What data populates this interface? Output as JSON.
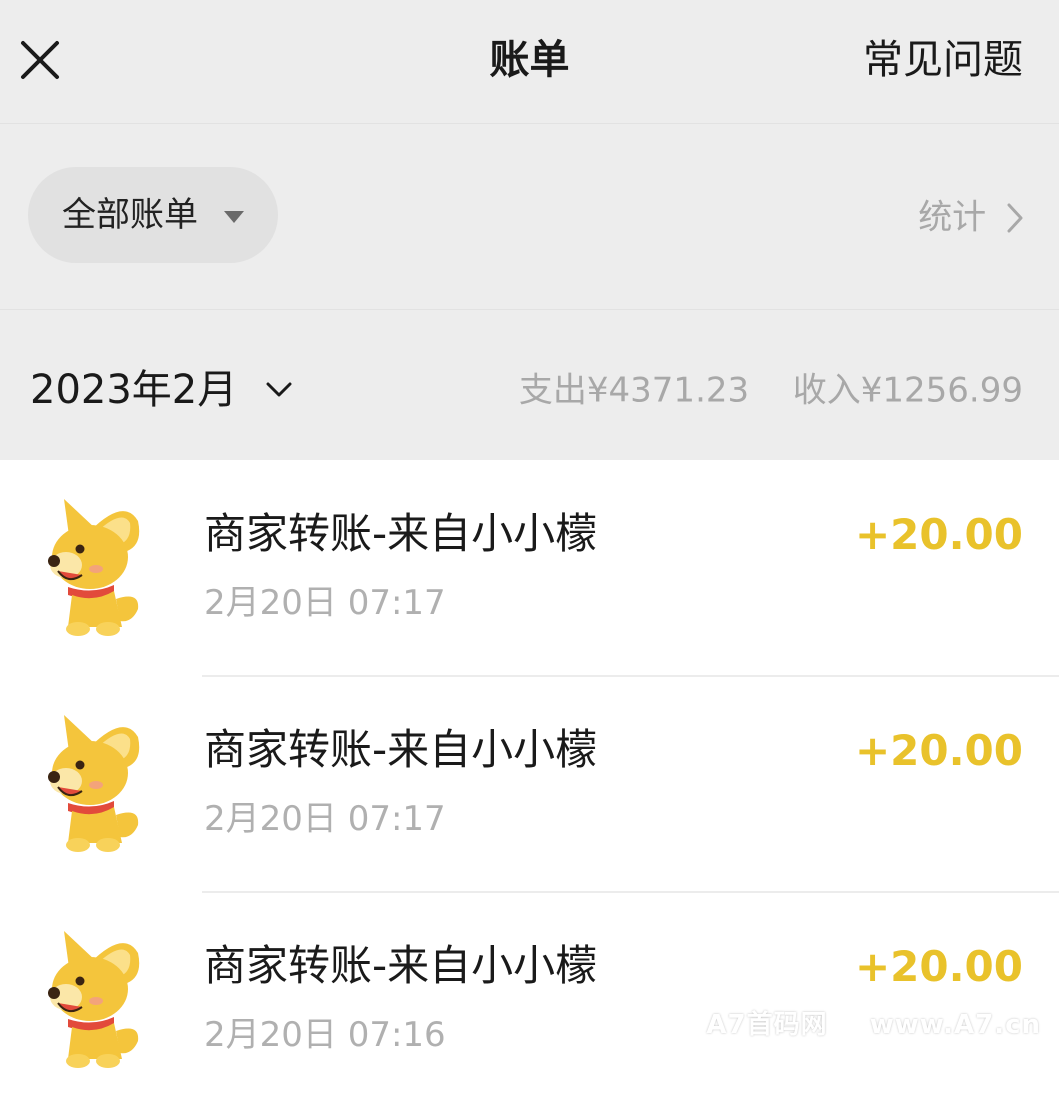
{
  "header": {
    "close_icon": "close-icon",
    "title": "账单",
    "faq_label": "常见问题"
  },
  "filter": {
    "selected": "全部账单",
    "stats_label": "统计"
  },
  "month": {
    "label": "2023年2月",
    "expense": "支出¥4371.23",
    "income": "收入¥1256.99"
  },
  "transactions": [
    {
      "title": "商家转账-来自小小檬",
      "time": "2月20日 07:17",
      "amount": "+20.00",
      "avatar_icon": "dog-avatar-icon"
    },
    {
      "title": "商家转账-来自小小檬",
      "time": "2月20日 07:17",
      "amount": "+20.00",
      "avatar_icon": "dog-avatar-icon"
    },
    {
      "title": "商家转账-来自小小檬",
      "time": "2月20日 07:16",
      "amount": "+20.00",
      "avatar_icon": "dog-avatar-icon"
    }
  ],
  "watermark": {
    "brand": "A7首码网",
    "url": "www.A7.cn"
  },
  "colors": {
    "header_bg": "#ededed",
    "pill_bg": "#e1e1e1",
    "income_amount": "#e9c22b",
    "muted_text": "#a8a8a8",
    "dog_fur": "#f4c53c",
    "dog_collar": "#e24a3b"
  }
}
